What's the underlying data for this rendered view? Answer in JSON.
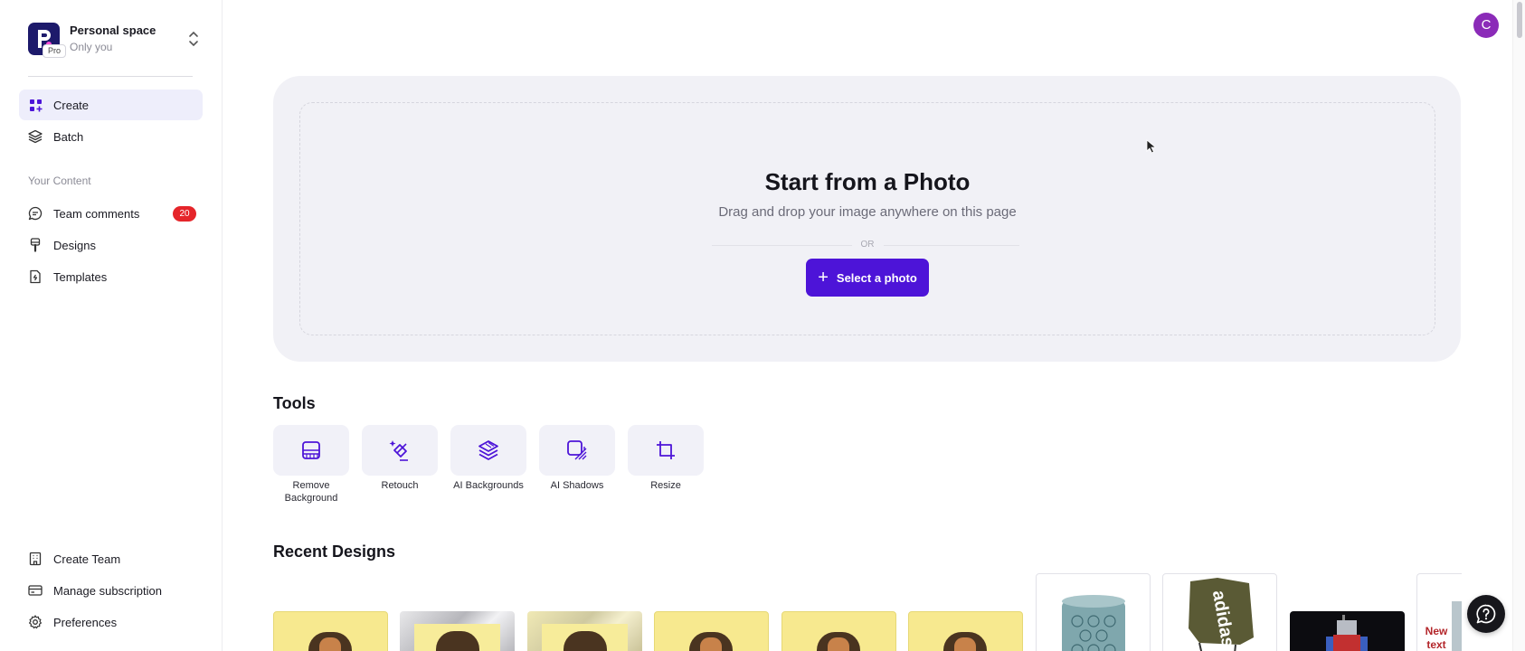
{
  "workspace": {
    "name": "Personal space",
    "subtitle": "Only you",
    "badge": "Pro"
  },
  "nav": {
    "create": "Create",
    "batch": "Batch",
    "section_label": "Your Content",
    "team_comments": "Team comments",
    "team_comments_count": "20",
    "designs": "Designs",
    "templates": "Templates",
    "create_team": "Create Team",
    "manage_subscription": "Manage subscription",
    "preferences": "Preferences"
  },
  "user": {
    "avatar_initial": "C",
    "avatar_color": "#8b2bb8"
  },
  "drop": {
    "title": "Start from a Photo",
    "subtitle": "Drag and drop your image anywhere on this page",
    "or": "OR",
    "button": "Select a photo"
  },
  "tools": {
    "title": "Tools",
    "items": [
      {
        "label": "Remove Background",
        "icon": "remove-background-icon"
      },
      {
        "label": "Retouch",
        "icon": "eraser-icon"
      },
      {
        "label": "AI Backgrounds",
        "icon": "layers-icon"
      },
      {
        "label": "AI Shadows",
        "icon": "shadow-icon"
      },
      {
        "label": "Resize",
        "icon": "crop-icon"
      }
    ]
  },
  "recent": {
    "title": "Recent Designs",
    "thumb_texts": {
      "adidas": "adidas",
      "new_text": "New text"
    }
  },
  "colors": {
    "accent": "#4d14d8",
    "badge": "#e5252a",
    "active_nav": "#eeeefb"
  }
}
